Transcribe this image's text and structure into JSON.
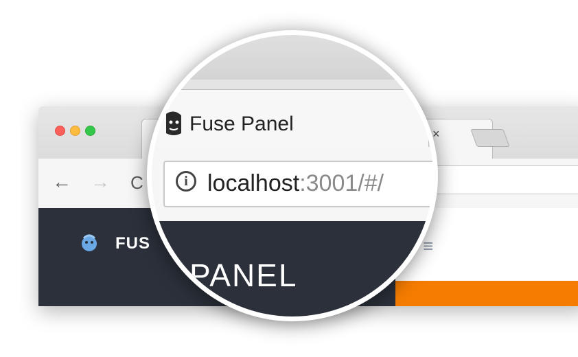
{
  "browser": {
    "tab_title": "Fuse Panel",
    "tab_close_icon": "×",
    "url_host": "localhost",
    "url_rest": ":3001/#/",
    "nav_back_icon": "←",
    "nav_forward_icon": "→",
    "reload_icon": "C"
  },
  "app": {
    "brand_partial": "FUS",
    "panel_word": "PANEL",
    "menu_icon": "≡",
    "accent_color": "#f57c00",
    "sidebar_color": "#2b303a"
  }
}
